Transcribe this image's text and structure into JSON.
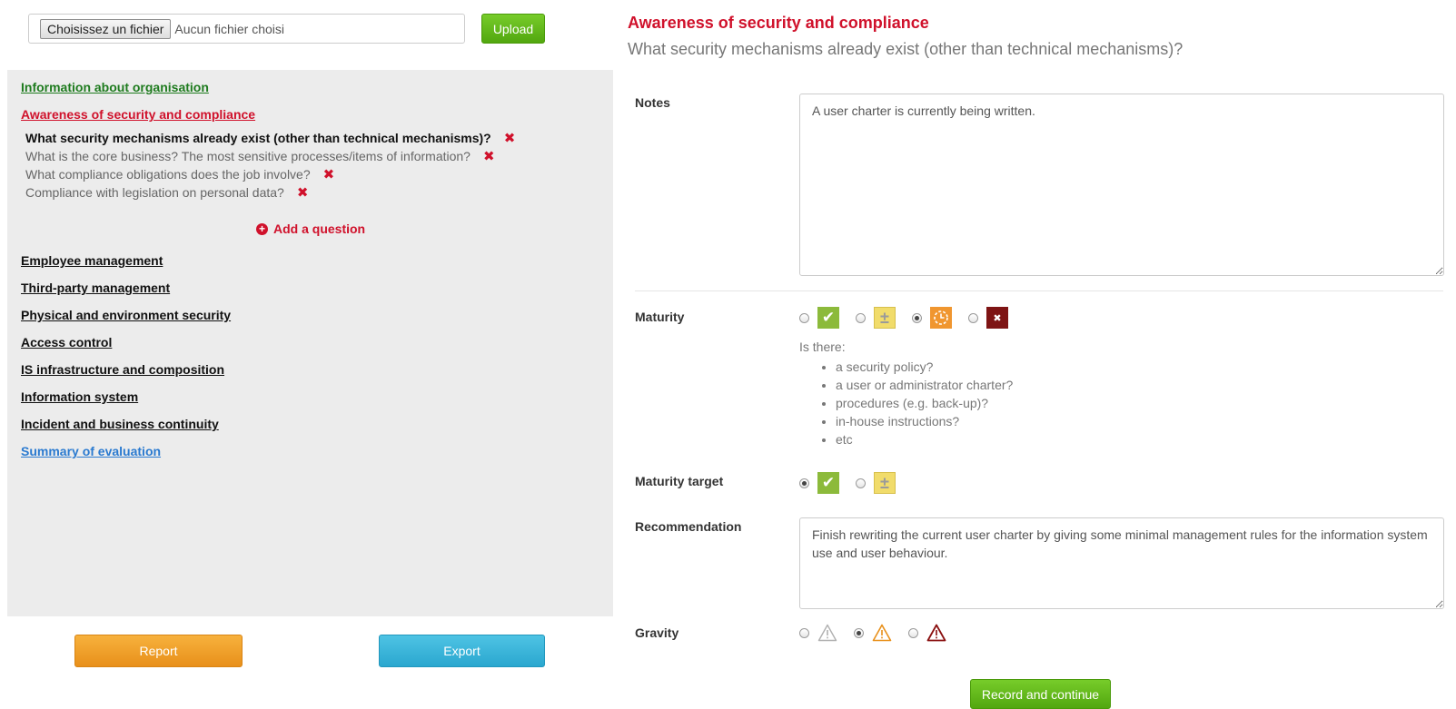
{
  "upload": {
    "choose_label": "Choisissez un fichier",
    "no_file_text": "Aucun fichier choisi",
    "upload_label": "Upload"
  },
  "sidebar": {
    "sections": [
      {
        "label": "Information about organisation",
        "color": "#1e7b1e"
      },
      {
        "label": "Awareness of security and compliance",
        "color": "#d0112b"
      },
      {
        "label": "Employee management",
        "color": "#111111"
      },
      {
        "label": "Third-party management",
        "color": "#111111"
      },
      {
        "label": "Physical and environment security",
        "color": "#111111"
      },
      {
        "label": "Access control",
        "color": "#111111"
      },
      {
        "label": "IS infrastructure and composition",
        "color": "#111111"
      },
      {
        "label": "Information system",
        "color": "#111111"
      },
      {
        "label": "Incident and business continuity",
        "color": "#111111"
      },
      {
        "label": "Summary of evaluation",
        "color": "#2a7ad0"
      }
    ],
    "questions": [
      {
        "label": "What security mechanisms already exist (other than technical mechanisms)?",
        "active": true
      },
      {
        "label": "What is the core business? The most sensitive processes/items of information?",
        "active": false
      },
      {
        "label": "What compliance obligations does the job involve?",
        "active": false
      },
      {
        "label": "Compliance with legislation on personal data?",
        "active": false
      }
    ],
    "delete_icon": "✖",
    "add_question_label": "Add a question"
  },
  "actions": {
    "report_label": "Report",
    "export_label": "Export",
    "record_label": "Record and continue"
  },
  "main": {
    "section_title": "Awareness of security and compliance",
    "question_title": "What security mechanisms already exist (other than technical mechanisms)?",
    "notes_label": "Notes",
    "notes_value": "A user charter is currently being written.",
    "maturity_label": "Maturity",
    "maturity_options": [
      "check",
      "plus-minus",
      "clock",
      "cross"
    ],
    "maturity_selected": "clock",
    "hint_intro": "Is there:",
    "hint_items": [
      "a security policy?",
      "a user or administrator charter?",
      "procedures (e.g. back-up)?",
      "in-house instructions?",
      "etc"
    ],
    "maturity_target_label": "Maturity target",
    "maturity_target_selected": "check",
    "recommendation_label": "Recommendation",
    "recommendation_value": "Finish rewriting the current user charter by giving some minimal management rules for the information system use and user behaviour.",
    "gravity_label": "Gravity",
    "gravity_options": [
      "low",
      "medium",
      "high"
    ],
    "gravity_selected": "medium"
  },
  "colors": {
    "accent_red": "#d0112b",
    "green": "#52a70f",
    "orange": "#e8901b",
    "blue": "#2aa7cf"
  }
}
